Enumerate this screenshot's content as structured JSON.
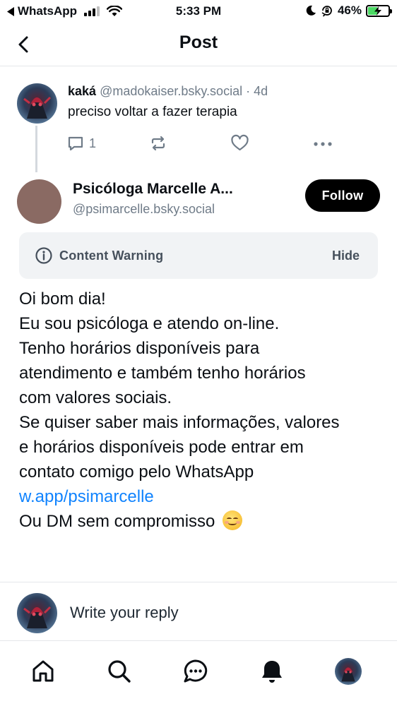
{
  "status_bar": {
    "back_app": "WhatsApp",
    "time": "5:33 PM",
    "battery": "46%",
    "battery_level": 0.46
  },
  "header": {
    "title": "Post"
  },
  "parent_post": {
    "author_name": "kaká",
    "author_handle": "@madokaiser.bsky.social",
    "separator": "·",
    "time_ago": "4d",
    "text": "preciso voltar a fazer terapia",
    "reply_count": "1"
  },
  "main_post": {
    "author_name": "Psicóloga Marcelle A...",
    "author_handle": "@psimarcelle.bsky.social",
    "follow_label": "Follow",
    "content_warning_label": "Content Warning",
    "content_warning_action": "Hide",
    "body_lines": [
      "Oi bom dia!",
      "Eu sou psicóloga e atendo on-line.",
      "Tenho horários disponíveis para",
      "atendimento e também tenho horários",
      "com valores sociais.",
      "Se quiser saber mais informações, valores",
      "e horários disponíveis pode entrar em",
      "contato comigo pelo WhatsApp"
    ],
    "link_text": "w.app/psimarcelle",
    "closing_line": "Ou DM sem compromisso"
  },
  "reply": {
    "placeholder": "Write your reply"
  },
  "tab_bar": {
    "items": [
      "home-icon",
      "search-icon",
      "chat-icon",
      "bell-icon",
      "profile-avatar"
    ]
  },
  "colors": {
    "link": "#1083fe",
    "muted": "#6f7b88",
    "follow_bg": "#000000",
    "battery_fill": "#4cd964",
    "content_warning_bg": "#f1f3f5"
  }
}
